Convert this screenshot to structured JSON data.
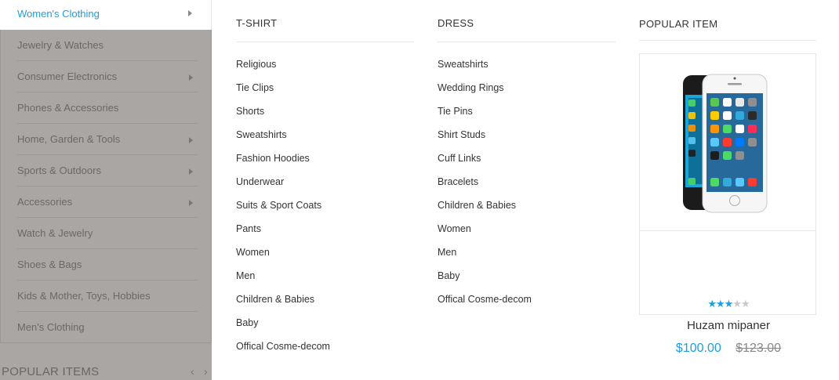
{
  "sidebar": {
    "active_item": {
      "label": "Women's Clothing",
      "has_submenu": true
    },
    "items": [
      {
        "label": "Jewelry & Watches",
        "has_submenu": false
      },
      {
        "label": "Consumer Electronics",
        "has_submenu": true
      },
      {
        "label": "Phones & Accessories",
        "has_submenu": false
      },
      {
        "label": "Home, Garden & Tools",
        "has_submenu": true
      },
      {
        "label": "Sports & Outdoors",
        "has_submenu": true
      },
      {
        "label": "Accessories",
        "has_submenu": true
      },
      {
        "label": "Watch & Jewelry",
        "has_submenu": false
      },
      {
        "label": "Shoes & Bags",
        "has_submenu": false
      },
      {
        "label": "Kids & Mother, Toys, Hobbies",
        "has_submenu": false
      },
      {
        "label": "Men's Clothing",
        "has_submenu": false
      }
    ],
    "popular_heading": "POPULAR ITEMS",
    "nav_prev": "‹",
    "nav_next": "›"
  },
  "menu": {
    "tshirt": {
      "title": "T-SHIRT",
      "links": [
        "Religious",
        "Tie Clips",
        "Shorts",
        "Sweatshirts",
        "Fashion Hoodies",
        "Underwear",
        "Suits & Sport Coats",
        "Pants",
        "Women",
        "Men",
        "Children & Babies",
        "Baby",
        "Offical Cosme-decom"
      ]
    },
    "dress": {
      "title": "DRESS",
      "links": [
        "Sweatshirts",
        "Wedding Rings",
        "Tie Pins",
        "Shirt Studs",
        "Cuff Links",
        "Bracelets",
        "Children & Babies",
        "Women",
        "Men",
        "Baby",
        "Offical Cosme-decom"
      ]
    },
    "popular": {
      "title": "POPULAR ITEM",
      "product": {
        "name": "Huzam mipaner",
        "rating": 3,
        "rating_max": 5,
        "price": "$100.00",
        "old_price": "$123.00",
        "image_icon": "smartphone-image"
      }
    }
  },
  "colors": {
    "accent": "#1a9fe0",
    "sidebar_overlay": "#a9a6a3",
    "star_off": "#c8c8c8"
  }
}
